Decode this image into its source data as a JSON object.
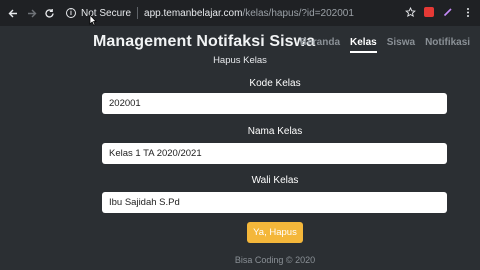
{
  "browser": {
    "security_label": "Not Secure",
    "url_host": "app.temanbelajar.com",
    "url_path": "/kelas/hapus/?id=202001",
    "icons": [
      "back-arrow-icon",
      "forward-arrow-icon",
      "reload-icon",
      "info-icon",
      "star-icon",
      "extension-icon",
      "pen-icon",
      "menu-icon"
    ]
  },
  "navbar": {
    "brand": "Management Notifaksi Siswa",
    "items": [
      {
        "label": "Beranda",
        "active": false
      },
      {
        "label": "Kelas",
        "active": true
      },
      {
        "label": "Siswa",
        "active": false
      },
      {
        "label": "Notifikasi",
        "active": false
      }
    ]
  },
  "form": {
    "title": "Hapus Kelas",
    "kode_label": "Kode Kelas",
    "kode_value": "202001",
    "nama_label": "Nama Kelas",
    "nama_value": "Kelas 1 TA 2020/2021",
    "wali_label": "Wali Kelas",
    "wali_value": "Ibu Sajidah S.Pd",
    "submit_label": "Ya, Hapus"
  },
  "footer": {
    "text": "Bisa Coding © 2020"
  },
  "colors": {
    "background": "#2b2f33",
    "button": "#f4b73a",
    "field": "#ffffff"
  }
}
